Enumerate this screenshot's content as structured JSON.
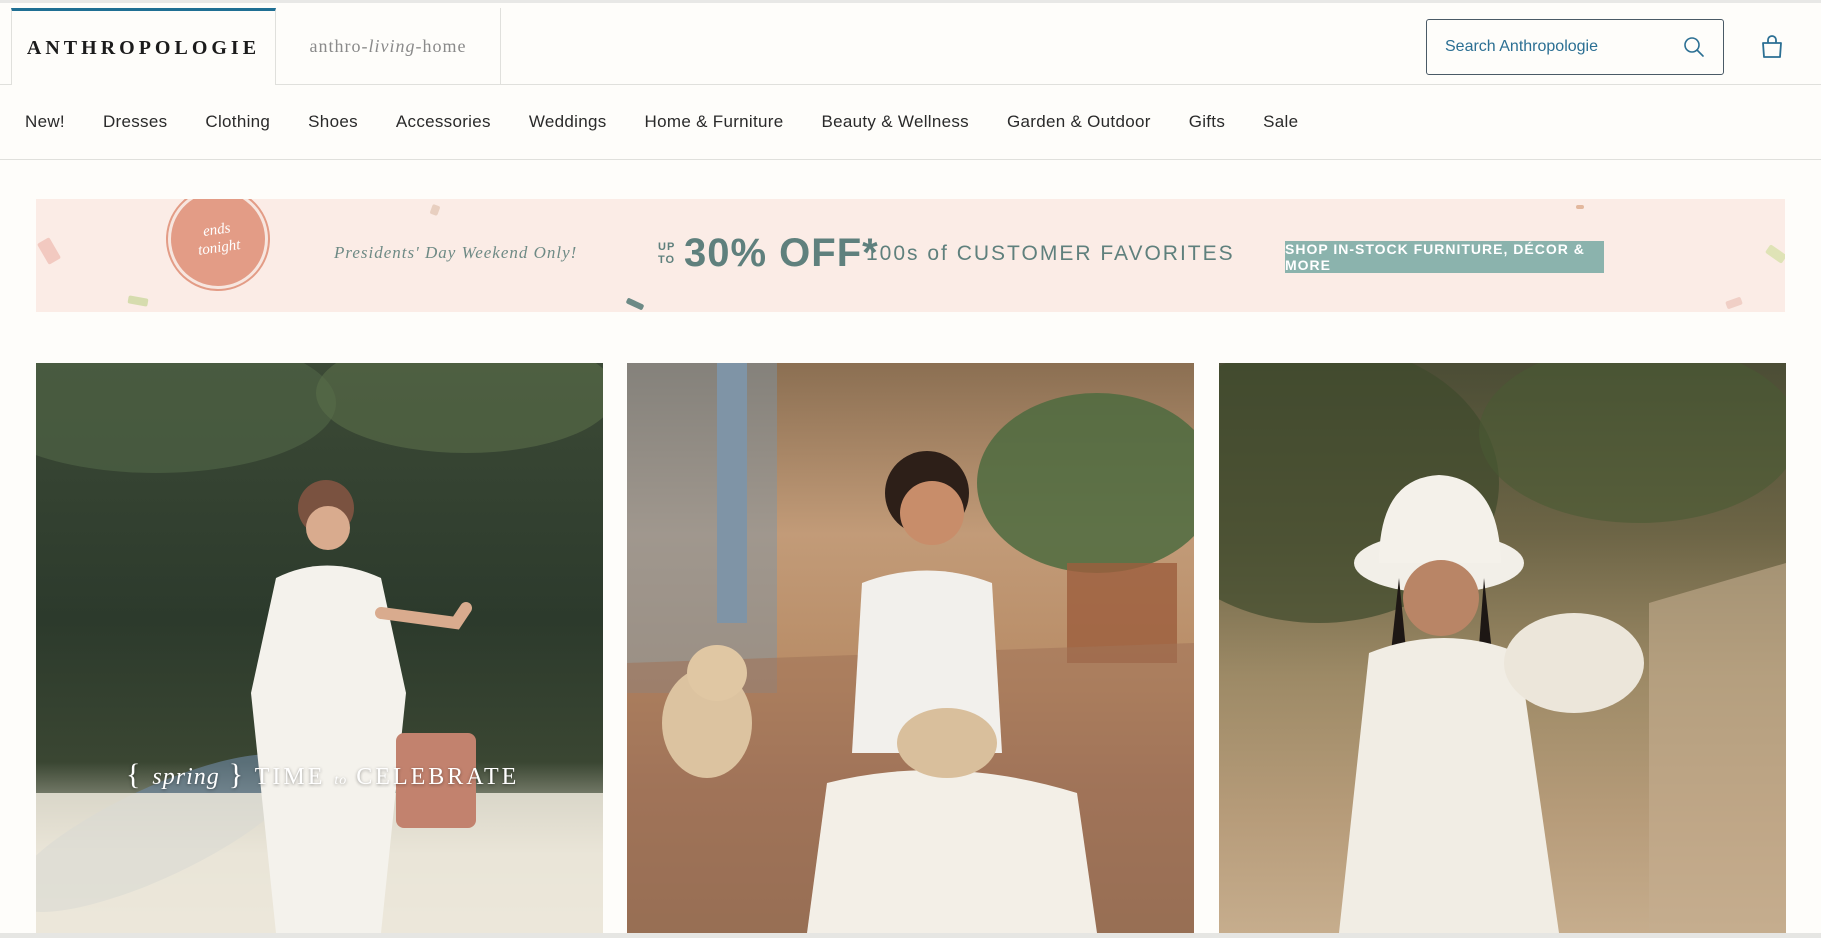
{
  "header": {
    "brand_primary": "ANTHROPOLOGIE",
    "brand_secondary_prefix": "anthro",
    "brand_secondary_mid": "living",
    "brand_secondary_suffix": "home",
    "search_placeholder": "Search Anthropologie",
    "icons": {
      "search": "search-icon",
      "cart": "shopping-bag-icon"
    },
    "accent_color": "#1f6f93"
  },
  "nav": {
    "items": [
      "New!",
      "Dresses",
      "Clothing",
      "Shoes",
      "Accessories",
      "Weddings",
      "Home & Furniture",
      "Beauty & Wellness",
      "Garden & Outdoor",
      "Gifts",
      "Sale"
    ]
  },
  "promo": {
    "badge_line1": "ends",
    "badge_line2": "tonight",
    "tagline": "Presidents' Day Weekend Only!",
    "upto_line1": "UP",
    "upto_line2": "TO",
    "headline": "30% OFF*",
    "subline": "100s of CUSTOMER FAVORITES",
    "cta": "SHOP IN-STOCK FURNITURE, DÉCOR & MORE",
    "colors": {
      "background": "#fbece6",
      "text": "#5f807d",
      "badge": "#e39c86",
      "cta": "#8bb3ad"
    }
  },
  "tiles": [
    {
      "caption_open": "{",
      "caption_italic": "spring",
      "caption_close": "}",
      "caption_main_1": "TIME",
      "caption_small": "to",
      "caption_main_2": "CELEBRATE"
    },
    {},
    {}
  ]
}
